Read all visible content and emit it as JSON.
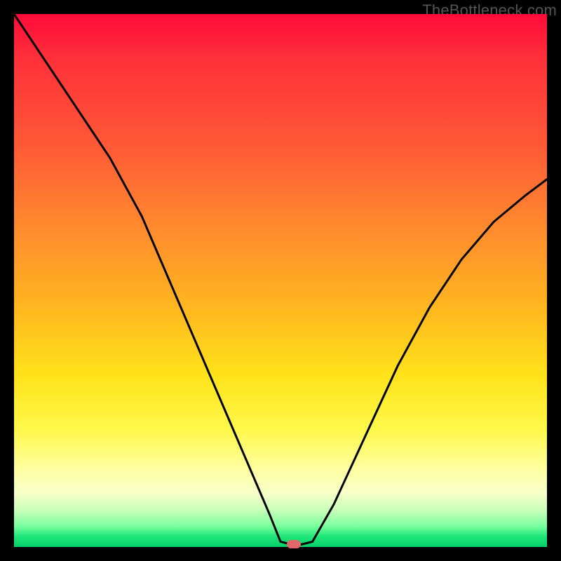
{
  "watermark": "TheBottleneck.com",
  "colors": {
    "curve": "#000000",
    "marker": "#e06868",
    "frame": "#000000"
  },
  "chart_data": {
    "type": "line",
    "title": "",
    "xlabel": "",
    "ylabel": "",
    "xlim": [
      0,
      100
    ],
    "ylim": [
      0,
      100
    ],
    "grid": false,
    "legend": false,
    "series": [
      {
        "name": "bottleneck-curve",
        "x": [
          0,
          6,
          12,
          18,
          24,
          30,
          36,
          42,
          48,
          50,
          52,
          54,
          56,
          60,
          66,
          72,
          78,
          84,
          90,
          96,
          100
        ],
        "values": [
          100,
          91,
          82,
          73,
          62,
          48,
          34,
          20,
          6,
          1,
          0.5,
          0.5,
          1,
          8,
          21,
          34,
          45,
          54,
          61,
          66,
          69
        ]
      }
    ],
    "minimum_marker": {
      "x": 52.5,
      "y": 0.5
    },
    "background_gradient": {
      "direction": "vertical",
      "stops": [
        {
          "pos": 0,
          "color": "#ff0a3a"
        },
        {
          "pos": 25,
          "color": "#ff5a36"
        },
        {
          "pos": 55,
          "color": "#ffb61f"
        },
        {
          "pos": 78,
          "color": "#fff84a"
        },
        {
          "pos": 93,
          "color": "#c9ffb8"
        },
        {
          "pos": 100,
          "color": "#06cf68"
        }
      ]
    }
  }
}
